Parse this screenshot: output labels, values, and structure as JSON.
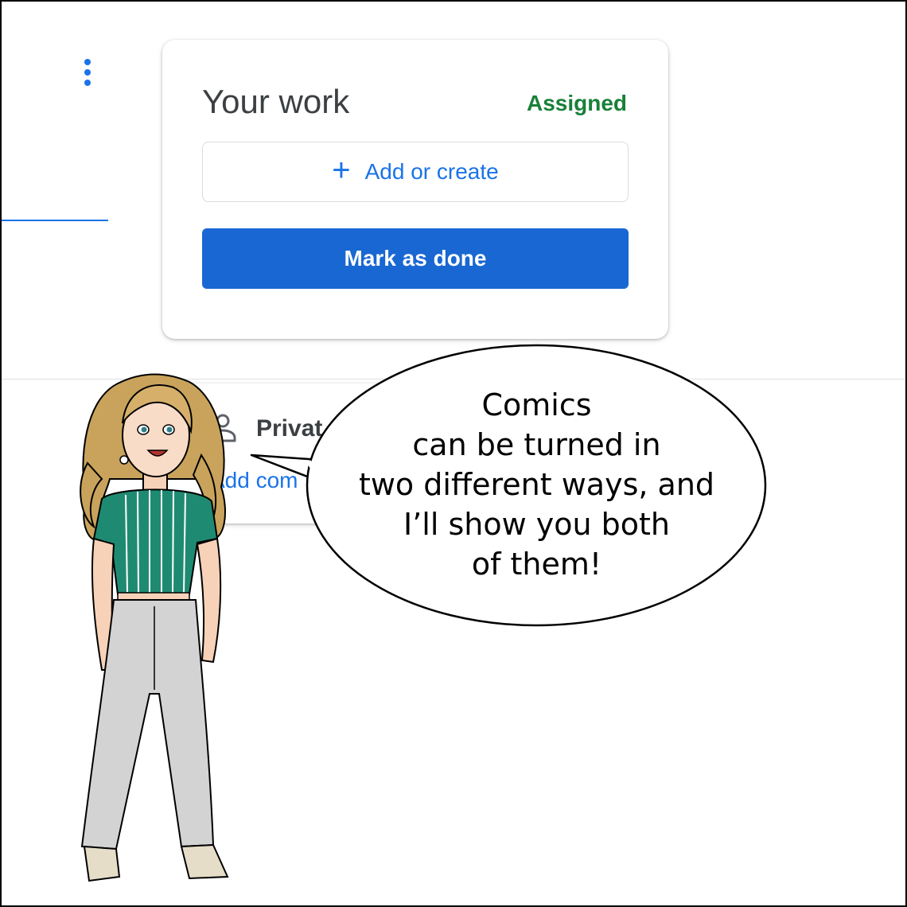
{
  "work_card": {
    "title": "Your work",
    "status": "Assigned",
    "add_button_label": "Add or create",
    "done_button_label": "Mark as done"
  },
  "private_card": {
    "label": "Privat",
    "add_comment_label": "Add com"
  },
  "speech": {
    "lines": [
      "Comics",
      "can be turned in",
      "two different ways, and",
      "I’ll show you both",
      "of them!"
    ]
  },
  "colors": {
    "accent": "#1a73e8",
    "button_primary": "#1967d2",
    "status_assigned": "#188038"
  }
}
